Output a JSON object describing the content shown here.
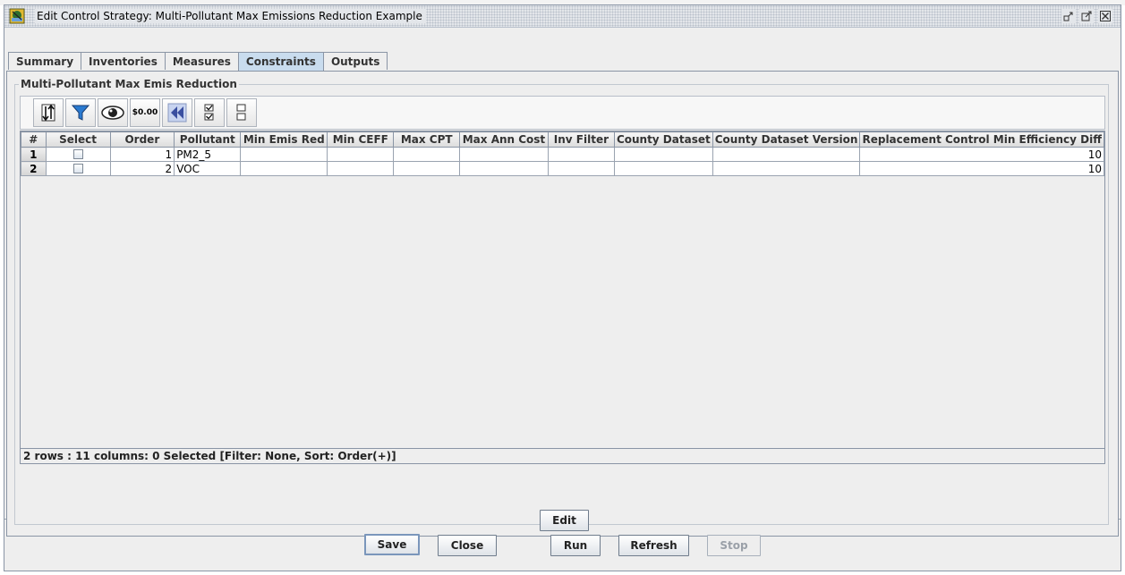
{
  "window": {
    "title": "Edit Control Strategy: Multi-Pollutant Max Emissions Reduction Example"
  },
  "tabs": [
    {
      "label": "Summary",
      "active": false
    },
    {
      "label": "Inventories",
      "active": false
    },
    {
      "label": "Measures",
      "active": false
    },
    {
      "label": "Constraints",
      "active": true
    },
    {
      "label": "Outputs",
      "active": false
    }
  ],
  "group": {
    "title": "Multi-Pollutant Max Emis Reduction"
  },
  "toolbar": {
    "icons": [
      "sort-icon",
      "filter-icon",
      "view-icon",
      "format-icon",
      "reset-icon",
      "select-all-icon",
      "clear-all-icon"
    ],
    "format_label": "$0.00"
  },
  "table": {
    "columns": [
      "#",
      "Select",
      "Order",
      "Pollutant",
      "Min Emis Red",
      "Min CEFF",
      "Max CPT",
      "Max Ann Cost",
      "Inv Filter",
      "County Dataset",
      "County Dataset Version",
      "Replacement Control Min Efficiency Diff"
    ],
    "rows": [
      {
        "num": "1",
        "selected": false,
        "order": "1",
        "pollutant": "PM2_5",
        "min_emis_red": "",
        "min_ceff": "",
        "max_cpt": "",
        "max_ann_cost": "",
        "inv_filter": "",
        "county_dataset": "",
        "county_dataset_version": "",
        "replacement_diff": "10"
      },
      {
        "num": "2",
        "selected": false,
        "order": "2",
        "pollutant": "VOC",
        "min_emis_red": "",
        "min_ceff": "",
        "max_cpt": "",
        "max_ann_cost": "",
        "inv_filter": "",
        "county_dataset": "",
        "county_dataset_version": "",
        "replacement_diff": "10"
      }
    ]
  },
  "status": {
    "text": "2 rows : 11 columns: 0 Selected [Filter: None, Sort: Order(+)]"
  },
  "buttons": {
    "edit": "Edit",
    "save": "Save",
    "close": "Close",
    "run": "Run",
    "refresh": "Refresh",
    "stop": "Stop"
  }
}
